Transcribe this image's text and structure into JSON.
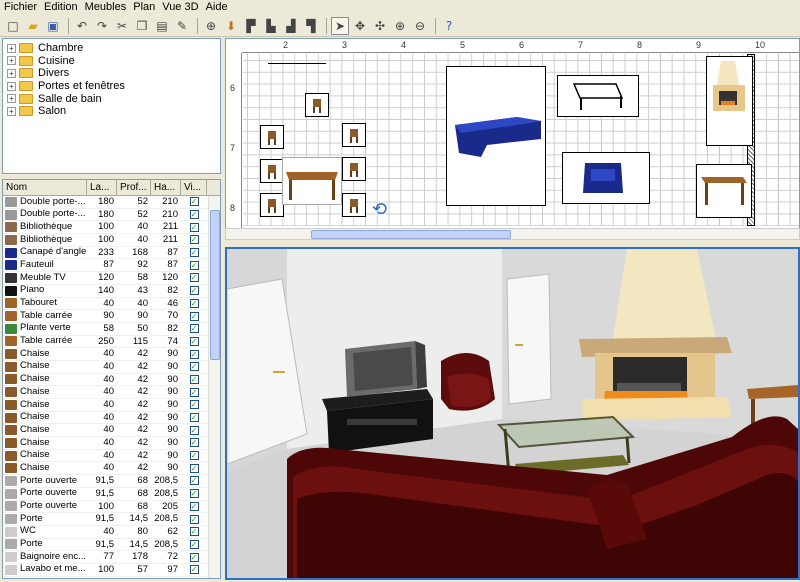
{
  "menu": [
    "Fichier",
    "Edition",
    "Meubles",
    "Plan",
    "Vue 3D",
    "Aide"
  ],
  "toolbar_icons": [
    "new-icon",
    "open-icon",
    "save-icon",
    "undo-icon",
    "redo-icon",
    "cut-icon",
    "copy-icon",
    "paste-icon",
    "delete-icon",
    "add-furniture-icon",
    "import-icon",
    "create-walls-icon",
    "create-rooms-icon",
    "create-dimensions-icon",
    "select-mode-icon",
    "pan-mode-icon",
    "rotate-icon",
    "zoom-in-icon",
    "zoom-out-icon",
    "help-icon"
  ],
  "catalog": [
    "Chambre",
    "Cuisine",
    "Divers",
    "Portes et fenêtres",
    "Salle de bain",
    "Salon"
  ],
  "furniture": {
    "headers": [
      "Nom",
      "La...",
      "Prof...",
      "Ha...",
      "Vi..."
    ],
    "rows": [
      [
        "Double porte-...",
        "180",
        "52",
        "210"
      ],
      [
        "Double porte-...",
        "180",
        "52",
        "210"
      ],
      [
        "Bibliothèque",
        "100",
        "40",
        "211"
      ],
      [
        "Bibliothèque",
        "100",
        "40",
        "211"
      ],
      [
        "Canapé d'angle",
        "233",
        "168",
        "87"
      ],
      [
        "Fauteuil",
        "87",
        "92",
        "87"
      ],
      [
        "Meuble TV",
        "120",
        "58",
        "120"
      ],
      [
        "Piano",
        "140",
        "43",
        "82"
      ],
      [
        "Tabouret",
        "40",
        "40",
        "46"
      ],
      [
        "Table carrée",
        "90",
        "90",
        "70"
      ],
      [
        "Plante verte",
        "58",
        "50",
        "82"
      ],
      [
        "Table carrée",
        "250",
        "115",
        "74"
      ],
      [
        "Chaise",
        "40",
        "42",
        "90"
      ],
      [
        "Chaise",
        "40",
        "42",
        "90"
      ],
      [
        "Chaise",
        "40",
        "42",
        "90"
      ],
      [
        "Chaise",
        "40",
        "42",
        "90"
      ],
      [
        "Chaise",
        "40",
        "42",
        "90"
      ],
      [
        "Chaise",
        "40",
        "42",
        "90"
      ],
      [
        "Chaise",
        "40",
        "42",
        "90"
      ],
      [
        "Chaise",
        "40",
        "42",
        "90"
      ],
      [
        "Chaise",
        "40",
        "42",
        "90"
      ],
      [
        "Chaise",
        "40",
        "42",
        "90"
      ],
      [
        "Porte ouverte",
        "91,5",
        "68",
        "208,5"
      ],
      [
        "Porte ouverte",
        "91,5",
        "68",
        "208,5"
      ],
      [
        "Porte ouverte",
        "100",
        "68",
        "205"
      ],
      [
        "Porte",
        "91,5",
        "14,5",
        "208,5"
      ],
      [
        "WC",
        "40",
        "80",
        "62"
      ],
      [
        "Porte",
        "91,5",
        "14,5",
        "208,5"
      ],
      [
        "Baignoire enc...",
        "77",
        "178",
        "72"
      ],
      [
        "Lavabo et me...",
        "100",
        "57",
        "97"
      ]
    ]
  },
  "plan": {
    "ruler_x": [
      "2",
      "3",
      "4",
      "5",
      "6",
      "7",
      "8",
      "9",
      "10"
    ],
    "ruler_y": [
      "6",
      "7",
      "8"
    ]
  },
  "colors": {
    "accent": "#2f6fc9",
    "sofa_3d": "#5a0a0a",
    "sofa_plan": "#1a2a8a",
    "wall": "#ffffff",
    "floor": "#d8d8d8"
  }
}
